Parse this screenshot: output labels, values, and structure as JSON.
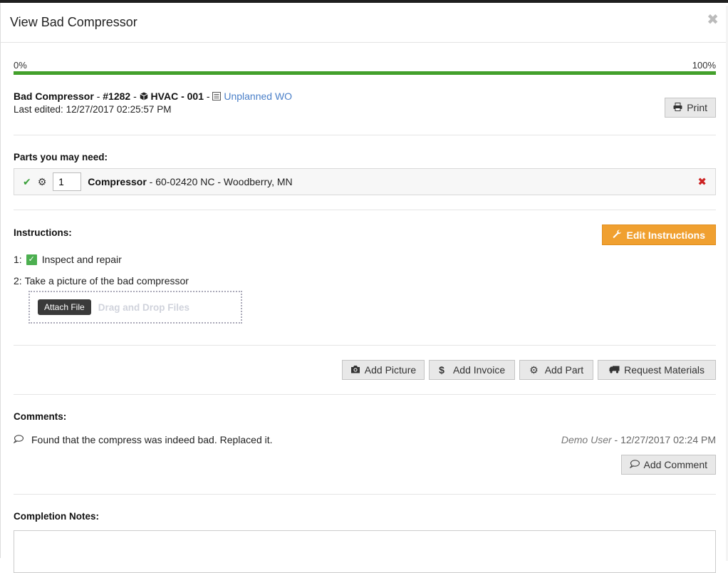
{
  "modal": {
    "title": "View Bad Compressor",
    "close_icon": "close-icon"
  },
  "progress": {
    "min_label": "0%",
    "max_label": "100%",
    "value_percent": 100,
    "color": "#43a02b"
  },
  "work_order": {
    "name": "Bad Compressor",
    "sep1": " - ",
    "number": "#1282",
    "sep2": " - ",
    "asset_icon": "cube-icon",
    "asset": "HVAC - 001",
    "sep3": " - ",
    "type_icon": "list-icon",
    "type": "Unplanned WO",
    "last_edited_label": "Last edited:",
    "last_edited": "12/27/2017 02:25:57 PM"
  },
  "print_button": {
    "label": "Print",
    "icon": "print-icon"
  },
  "parts": {
    "label": "Parts you may need:",
    "items": [
      {
        "status_icon": "check-icon",
        "settings_icon": "gear-icon",
        "quantity": "1",
        "name": "Compressor",
        "detail": " - 60-02420 NC - Woodberry, MN",
        "remove_icon": "remove-icon"
      }
    ]
  },
  "instructions": {
    "label": "Instructions:",
    "edit_button": {
      "label": "Edit Instructions",
      "icon": "wrench-icon"
    },
    "edit_color": "#f0a030",
    "steps": [
      {
        "number": "1:",
        "text": "Inspect and repair",
        "checked": true
      },
      {
        "number": "2:",
        "text": "Take a picture of the bad compressor"
      }
    ],
    "attach_button": "Attach File",
    "drop_text": "Drag and Drop Files"
  },
  "actions": [
    {
      "label": "Add Picture",
      "icon": "camera-icon"
    },
    {
      "label": "Add Invoice",
      "icon": "dollar-icon"
    },
    {
      "label": "Add Part",
      "icon": "gear-icon"
    },
    {
      "label": "Request Materials",
      "icon": "truck-icon"
    }
  ],
  "comments": {
    "label": "Comments:",
    "items": [
      {
        "text": "Found that the compress was indeed bad. Replaced it.",
        "author": "Demo User",
        "sep": " - ",
        "timestamp": "12/27/2017 02:24 PM"
      }
    ],
    "add_button": {
      "label": "Add Comment",
      "icon": "comment-icon"
    }
  },
  "completion": {
    "label": "Completion Notes:",
    "value": ""
  }
}
